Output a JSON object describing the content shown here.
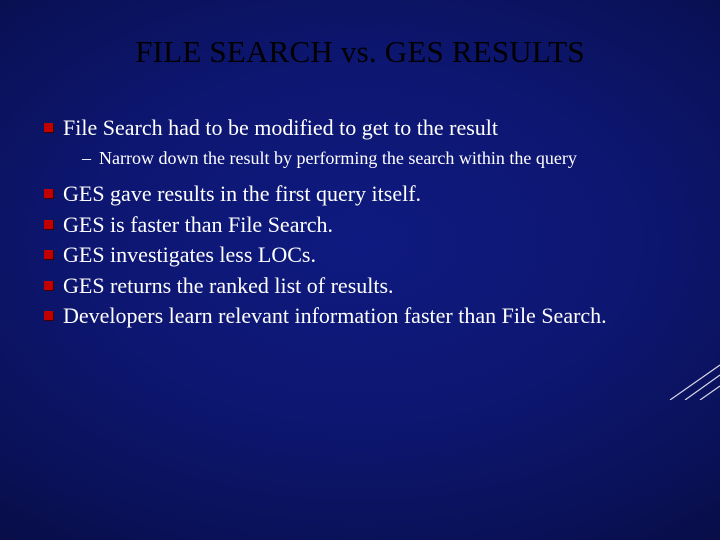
{
  "title": "FILE SEARCH vs. GES RESULTS",
  "items": [
    {
      "level": 1,
      "text": "File Search had to be modified to get to the result"
    },
    {
      "level": 2,
      "text": "Narrow down the result by performing the search within the query"
    },
    {
      "level": 1,
      "text": " GES gave results in the first query itself."
    },
    {
      "level": 1,
      "text": "GES is faster than File Search."
    },
    {
      "level": 1,
      "text": "GES investigates less LOCs."
    },
    {
      "level": 1,
      "text": "GES returns the ranked list of results."
    },
    {
      "level": 1,
      "text": "Developers learn relevant information faster than File Search."
    }
  ]
}
